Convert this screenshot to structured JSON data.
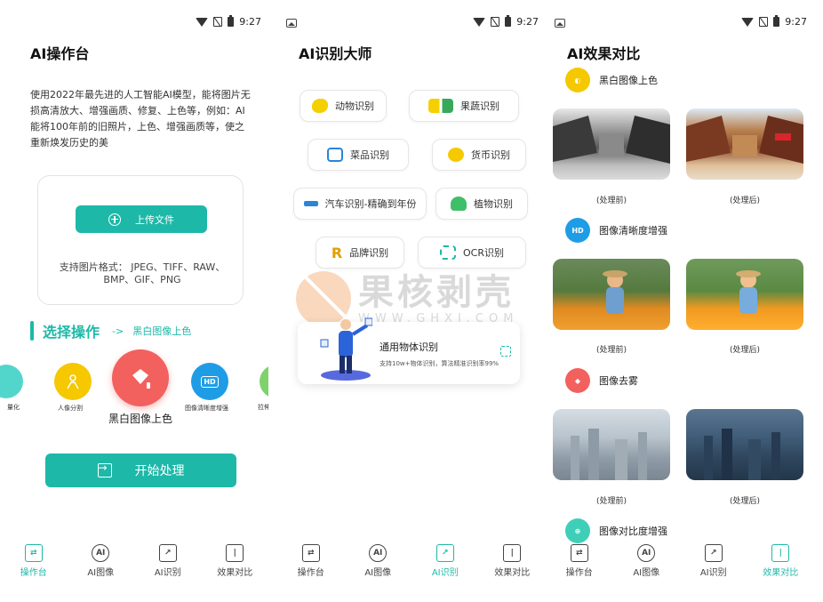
{
  "status": {
    "time": "9:27"
  },
  "panel1": {
    "title": "AI操作台",
    "description": "使用2022年最先进的人工智能AI模型，能将图片无损高清放大、增强画质、修复、上色等，例如：AI能将100年前的旧照片，上色、增强画质等，使之重新焕发历史的美",
    "upload_label": "上传文件",
    "formats_label": "支持图片格式： JPEG、TIFF、RAW、BMP、GIF、PNG",
    "section_title": "选择操作",
    "section_arrow": "->",
    "section_selected": "黑白图像上色",
    "ops": [
      {
        "label": "量化",
        "color": "#52d6cc"
      },
      {
        "label": "人像分割",
        "color": "#f5c800"
      },
      {
        "label": "黑白图像上色",
        "color": "#f2615e"
      },
      {
        "label": "图像清晰度增强",
        "color": "#1e9de6"
      },
      {
        "label": "拉伸",
        "color": "#7ed26b"
      }
    ],
    "start_label": "开始处理"
  },
  "panel2": {
    "title": "AI识别大师",
    "chips": [
      {
        "label": "动物识别",
        "icon": "animal-icon"
      },
      {
        "label": "果蔬识别",
        "icon": "fruit-icon"
      },
      {
        "label": "菜品识别",
        "icon": "dish-icon"
      },
      {
        "label": "货币识别",
        "icon": "currency-icon"
      },
      {
        "label": "汽车识别-精确到年份",
        "icon": "car-icon"
      },
      {
        "label": "植物识别",
        "icon": "plant-icon"
      },
      {
        "label": "品牌识别",
        "icon": "brand-icon"
      },
      {
        "label": "OCR识别",
        "icon": "ocr-icon"
      }
    ],
    "general_title": "通用物体识别",
    "general_sub": "支持10w+物体识别，算法精准识别率99%",
    "watermark_cn": "果核剥壳",
    "watermark_en": "WWW.GHXI.COM"
  },
  "panel3": {
    "title": "AI效果对比",
    "sections": [
      {
        "label": "黑白图像上色",
        "icon_color": "#f5c800",
        "before": "(处理前)",
        "after": "(处理后)"
      },
      {
        "label": "图像清晰度增强",
        "icon_color": "#1e9de6",
        "icon_text": "HD",
        "before": "(处理前)",
        "after": "(处理后)"
      },
      {
        "label": "图像去雾",
        "icon_color": "#f2615e",
        "before": "(处理前)",
        "after": "(处理后)"
      },
      {
        "label": "图像对比度增强",
        "icon_color": "#3fcfb8"
      }
    ]
  },
  "tabs": [
    {
      "label": "操作台",
      "icon": "console-icon"
    },
    {
      "label": "AI图像",
      "icon": "ai-image-icon"
    },
    {
      "label": "AI识别",
      "icon": "ai-recognize-icon"
    },
    {
      "label": "效果对比",
      "icon": "compare-icon"
    }
  ],
  "colors": {
    "accent": "#1db8a8"
  }
}
